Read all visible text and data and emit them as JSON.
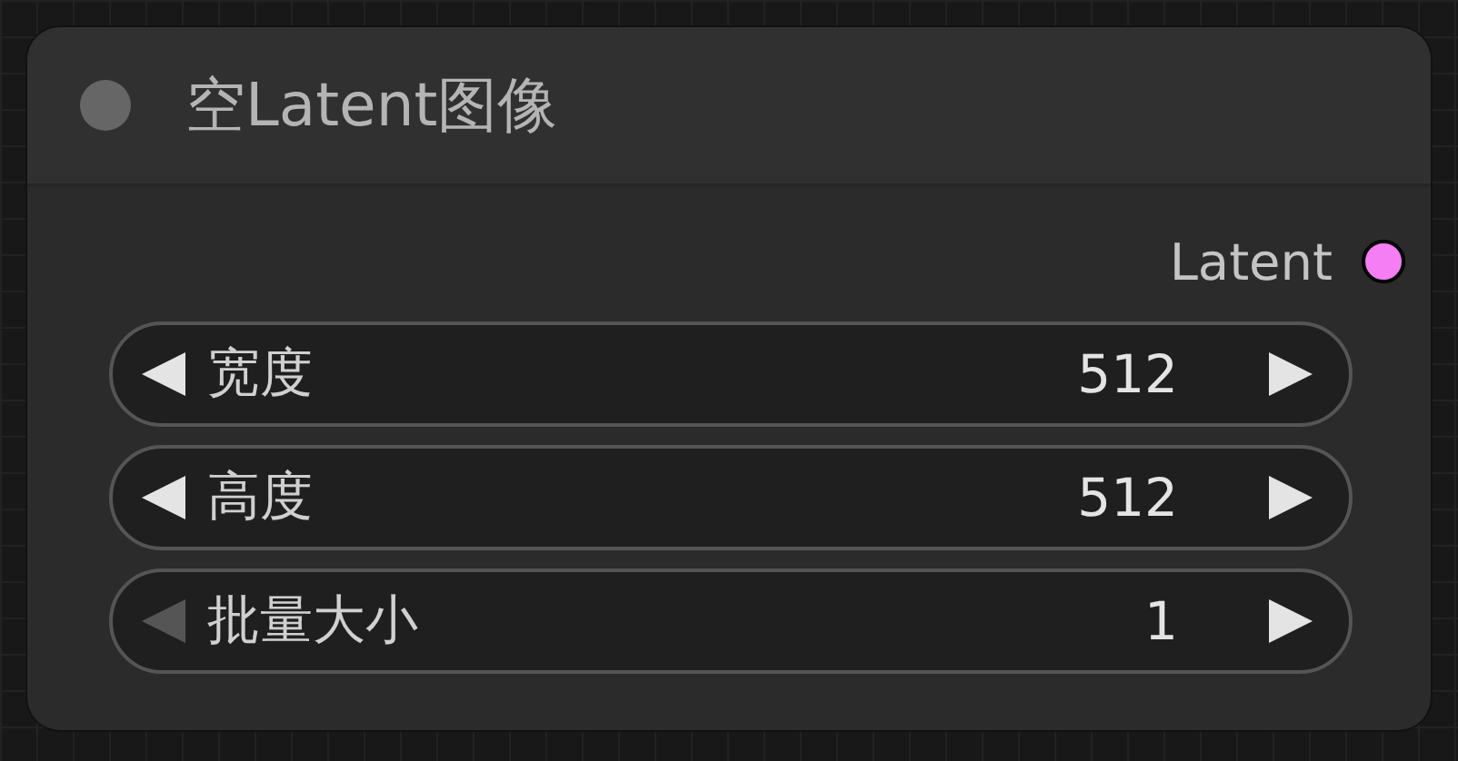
{
  "node": {
    "title": "空Latent图像",
    "outputs": [
      {
        "label": "Latent",
        "color": "#f57ef5"
      }
    ],
    "widgets": [
      {
        "label": "宽度",
        "value": "512",
        "decrement_disabled": false
      },
      {
        "label": "高度",
        "value": "512",
        "decrement_disabled": false
      },
      {
        "label": "批量大小",
        "value": "1",
        "decrement_disabled": true
      }
    ]
  }
}
